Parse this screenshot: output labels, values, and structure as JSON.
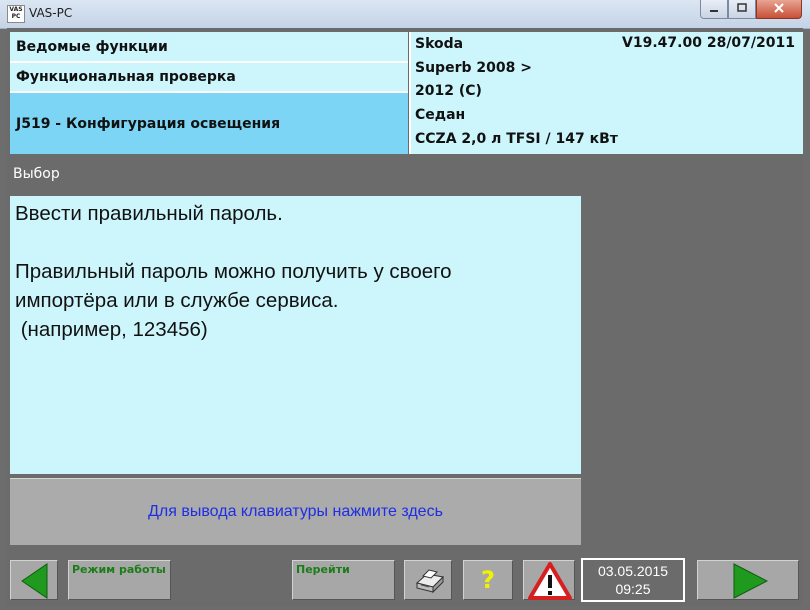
{
  "window": {
    "title": "VAS-PC",
    "app_icon_text": "VAS PC",
    "buttons": [
      "minimize-icon",
      "maximize-icon",
      "close-icon"
    ]
  },
  "header": {
    "left": {
      "row1": "Ведомые функции",
      "row2": "Функциональная проверка",
      "row3": "J519 - Конфигурация освещения"
    },
    "right": {
      "brand": "Skoda",
      "version": "V19.47.00 28/07/2011",
      "model": "Superb 2008 >",
      "year": "2012 (C)",
      "body": "Седан",
      "engine": "CCZA 2,0 л TFSI / 147 кВт"
    }
  },
  "section": {
    "label": "Выбор"
  },
  "message": {
    "line1": "Ввести правильный пароль.",
    "line2": "Правильный пароль можно получить у своего",
    "line3": "импортёра или в службе сервиса.",
    "line4": " (например, 123456)"
  },
  "keyboard_button": {
    "label": "Для вывода клавиатуры нажмите здесь"
  },
  "toolbar": {
    "mode_label": "Режим работы",
    "go_label": "Перейти",
    "help_symbol": "?",
    "date": "03.05.2015",
    "time": "09:25",
    "icons": [
      "arrow-left-icon",
      "printer-icon",
      "help-icon",
      "warning-icon",
      "arrow-right-icon"
    ]
  },
  "colors": {
    "panel_light": "#cdf6fc",
    "panel_selected": "#7cd5f4",
    "background": "#6b6b6b",
    "button": "#a7a7a7",
    "arrow_green": "#1f9a1f",
    "label_green": "#1b7d18",
    "link_blue": "#1e2ee2",
    "help_yellow": "#f2f200",
    "warning_red": "#d62020"
  }
}
